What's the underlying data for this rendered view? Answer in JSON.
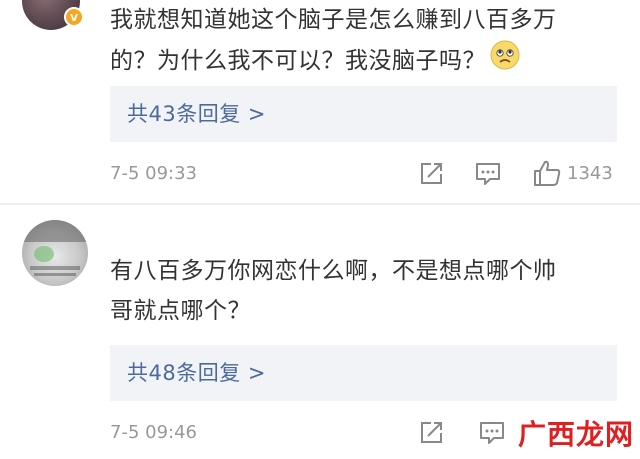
{
  "comments": [
    {
      "text_line1": "我就想知道她这个脑子是怎么赚到八百多万",
      "text_line2": "的？为什么我不可以？我没脑子吗？",
      "emoji": "worried-face-emoji",
      "reply_label": "共43条回复 >",
      "time": "7-5 09:33",
      "like_count": "1343",
      "avatar_icon": "user-avatar",
      "verified_badge": "verified-badge-icon"
    },
    {
      "text_line1": "有八百多万你网恋什么啊，不是想点哪个帅",
      "text_line2": "哥就点哪个？",
      "reply_label": "共48条回复 >",
      "time": "7-5 09:46",
      "avatar_icon": "user-avatar"
    }
  ],
  "watermark": "广西龙网",
  "colors": {
    "link": "#4c6b9a",
    "meta": "#999999",
    "reply_bg": "#f2f3f7",
    "badge": "#f5a623",
    "watermark": "#e02020"
  }
}
